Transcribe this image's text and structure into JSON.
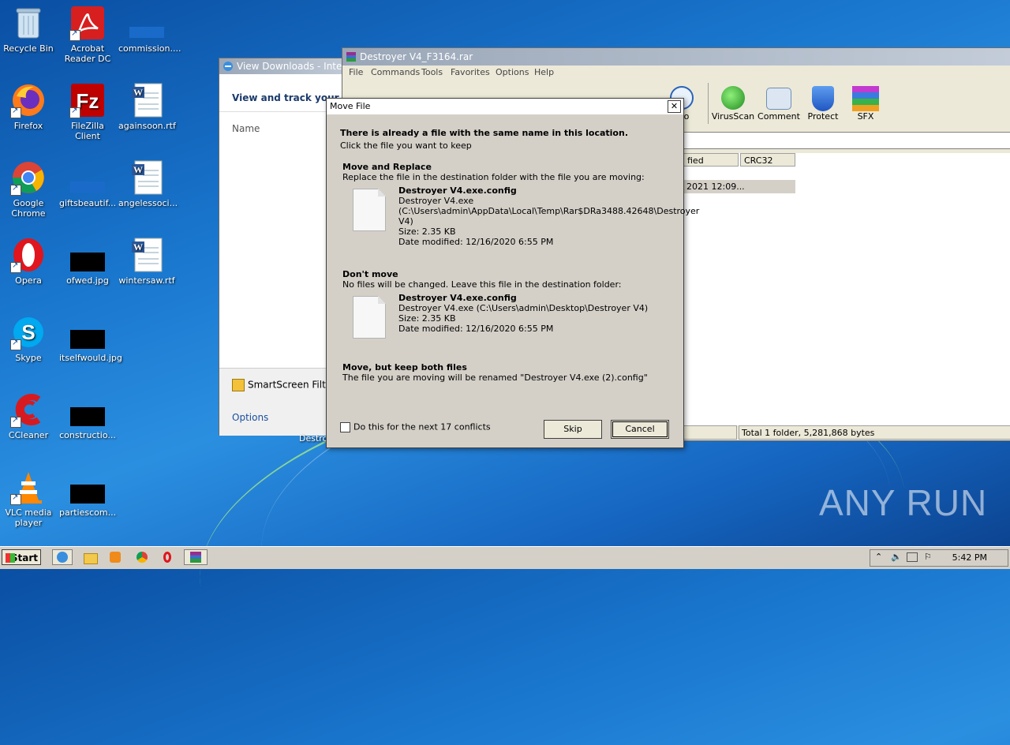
{
  "desktop": {
    "icons": [
      {
        "label": "Recycle Bin"
      },
      {
        "label": "Acrobat Reader DC"
      },
      {
        "label": "commission...."
      },
      {
        "label": "Firefox"
      },
      {
        "label": "FileZilla Client"
      },
      {
        "label": "againsoon.rtf"
      },
      {
        "label": "Google Chrome"
      },
      {
        "label": "giftsbeautif..."
      },
      {
        "label": "angelessoci..."
      },
      {
        "label": "Opera"
      },
      {
        "label": "ofwed.jpg"
      },
      {
        "label": "wintersaw.rtf"
      },
      {
        "label": "Skype"
      },
      {
        "label": "itselfwould.jpg"
      },
      {
        "label": "CCleaner"
      },
      {
        "label": "constructio..."
      },
      {
        "label": "VLC media player"
      },
      {
        "label": "partiescom..."
      }
    ],
    "watermark": "ANY RUN",
    "behind_label": "Destro"
  },
  "ie_window": {
    "title": "View Downloads - Interr",
    "header": "View and track your dow",
    "column_name": "Name",
    "smartscreen": "SmartScreen Filter",
    "options": "Options"
  },
  "winrar": {
    "title": "Destroyer V4_F3164.rar",
    "menu": [
      "File",
      "Commands",
      "Tools",
      "Favorites",
      "Options",
      "Help"
    ],
    "toolbar": [
      "o",
      "VirusScan",
      "Comment",
      "Protect",
      "SFX"
    ],
    "col_modified": "fied",
    "col_crc": "CRC32",
    "row_modified": "2021 12:09...",
    "status": "Total 1 folder, 5,281,868 bytes"
  },
  "dialog": {
    "title": "Move File",
    "heading": "There is already a file with the same name in this location.",
    "sub": "Click the file you want to keep",
    "opt1": {
      "title": "Move and Replace",
      "desc": "Replace the file in the destination folder with the file you are moving:",
      "filename": "Destroyer V4.exe.config",
      "line1": "Destroyer V4.exe",
      "line2": "(C:\\Users\\admin\\AppData\\Local\\Temp\\Rar$DRa3488.42648\\Destroyer",
      "line3": "V4)",
      "size": "Size: 2.35 KB",
      "date": "Date modified: 12/16/2020 6:55 PM"
    },
    "opt2": {
      "title": "Don't move",
      "desc": "No files will be changed. Leave this file in the destination folder:",
      "filename": "Destroyer V4.exe.config",
      "line1": "Destroyer V4.exe (C:\\Users\\admin\\Desktop\\Destroyer V4)",
      "size": "Size: 2.35 KB",
      "date": "Date modified: 12/16/2020 6:55 PM"
    },
    "opt3": {
      "title": "Move, but keep both files",
      "desc": "The file you are moving will be renamed \"Destroyer V4.exe (2).config\""
    },
    "checkbox": "Do this for the next 17 conflicts",
    "skip": "Skip",
    "cancel": "Cancel"
  },
  "taskbar": {
    "start": "Start",
    "clock": "5:42 PM"
  }
}
